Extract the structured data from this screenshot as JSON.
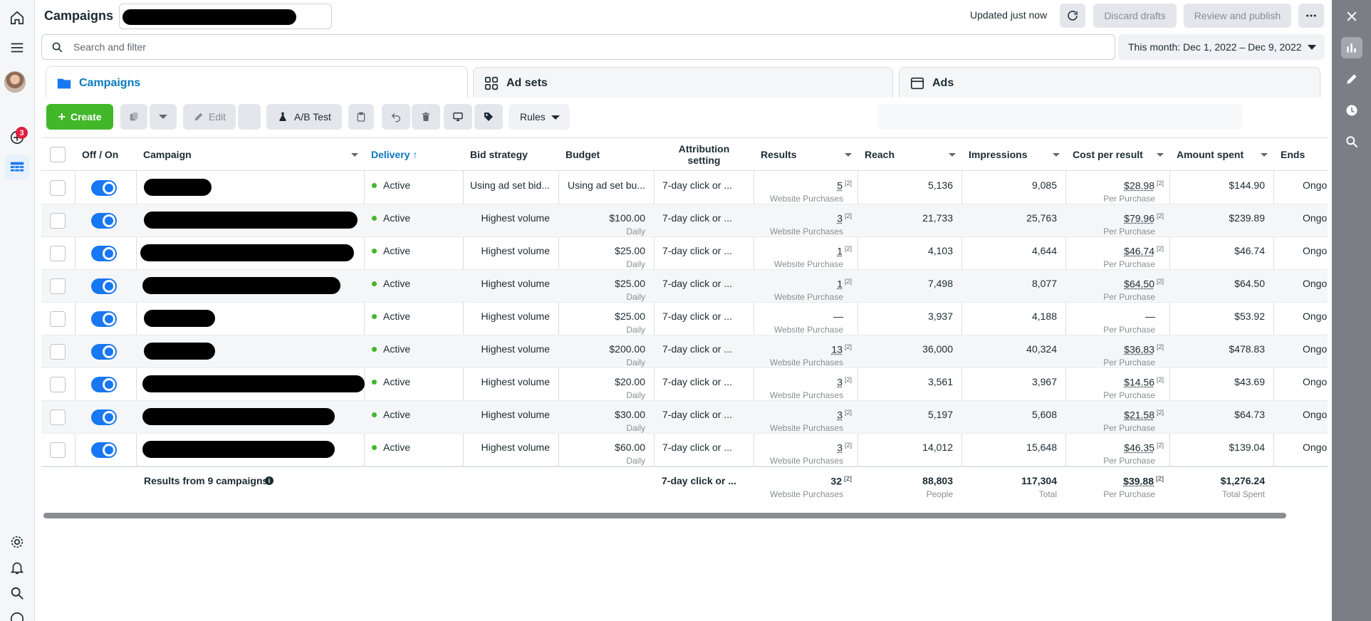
{
  "header": {
    "title": "Campaigns",
    "updated": "Updated just now",
    "discard": "Discard drafts",
    "review": "Review and publish"
  },
  "nav": {
    "notifications_count": "3"
  },
  "search": {
    "placeholder": "Search and filter"
  },
  "date_range": "This month: Dec 1, 2022 – Dec 9, 2022",
  "tabs": [
    {
      "label": "Campaigns"
    },
    {
      "label": "Ad sets"
    },
    {
      "label": "Ads"
    }
  ],
  "toolbar": {
    "create": "Create",
    "edit": "Edit",
    "ab_test": "A/B Test",
    "rules": "Rules"
  },
  "columns": {
    "off_on": "Off / On",
    "campaign": "Campaign",
    "delivery": "Delivery",
    "bid_strategy": "Bid strategy",
    "budget": "Budget",
    "attribution_line1": "Attribution",
    "attribution_line2": "setting",
    "results": "Results",
    "reach": "Reach",
    "impressions": "Impressions",
    "cost_per_result": "Cost per result",
    "amount_spent": "Amount spent",
    "ends": "Ends"
  },
  "rows": [
    {
      "delivery": "Active",
      "bid": "Using ad set bid...",
      "budget": "Using ad set bu...",
      "budget_sub": "",
      "attribution": "7-day click or ...",
      "results": "5",
      "results_sub": "Website Purchases",
      "reach": "5,136",
      "impressions": "9,085",
      "cpr": "$28.98",
      "cpr_sub": "Per Purchase",
      "spent": "$144.90",
      "ends": "Ongoing"
    },
    {
      "delivery": "Active",
      "bid": "Highest volume",
      "budget": "$100.00",
      "budget_sub": "Daily",
      "attribution": "7-day click or ...",
      "results": "3",
      "results_sub": "Website Purchases",
      "reach": "21,733",
      "impressions": "25,763",
      "cpr": "$79.96",
      "cpr_sub": "Per Purchase",
      "spent": "$239.89",
      "ends": "Ongoing"
    },
    {
      "delivery": "Active",
      "bid": "Highest volume",
      "budget": "$25.00",
      "budget_sub": "Daily",
      "attribution": "7-day click or ...",
      "results": "1",
      "results_sub": "Website Purchase",
      "reach": "4,103",
      "impressions": "4,644",
      "cpr": "$46.74",
      "cpr_sub": "Per Purchase",
      "spent": "$46.74",
      "ends": "Ongoing"
    },
    {
      "delivery": "Active",
      "bid": "Highest volume",
      "budget": "$25.00",
      "budget_sub": "Daily",
      "attribution": "7-day click or ...",
      "results": "1",
      "results_sub": "Website Purchase",
      "reach": "7,498",
      "impressions": "8,077",
      "cpr": "$64.50",
      "cpr_sub": "Per Purchase",
      "spent": "$64.50",
      "ends": "Ongoing"
    },
    {
      "delivery": "Active",
      "bid": "Highest volume",
      "budget": "$25.00",
      "budget_sub": "Daily",
      "attribution": "7-day click or ...",
      "results": "—",
      "results_sub": "Website Purchase",
      "reach": "3,937",
      "impressions": "4,188",
      "cpr": "—",
      "cpr_sub": "Per Purchase",
      "spent": "$53.92",
      "ends": "Ongoing"
    },
    {
      "delivery": "Active",
      "bid": "Highest volume",
      "budget": "$200.00",
      "budget_sub": "Daily",
      "attribution": "7-day click or ...",
      "results": "13",
      "results_sub": "Website Purchases",
      "reach": "36,000",
      "impressions": "40,324",
      "cpr": "$36.83",
      "cpr_sub": "Per Purchase",
      "spent": "$478.83",
      "ends": "Ongoing"
    },
    {
      "delivery": "Active",
      "bid": "Highest volume",
      "budget": "$20.00",
      "budget_sub": "Daily",
      "attribution": "7-day click or ...",
      "results": "3",
      "results_sub": "Website Purchases",
      "reach": "3,561",
      "impressions": "3,967",
      "cpr": "$14.56",
      "cpr_sub": "Per Purchase",
      "spent": "$43.69",
      "ends": "Ongoing"
    },
    {
      "delivery": "Active",
      "bid": "Highest volume",
      "budget": "$30.00",
      "budget_sub": "Daily",
      "attribution": "7-day click or ...",
      "results": "3",
      "results_sub": "Website Purchases",
      "reach": "5,197",
      "impressions": "5,608",
      "cpr": "$21.58",
      "cpr_sub": "Per Purchase",
      "spent": "$64.73",
      "ends": "Ongoing"
    },
    {
      "delivery": "Active",
      "bid": "Highest volume",
      "budget": "$60.00",
      "budget_sub": "Daily",
      "attribution": "7-day click or ...",
      "results": "3",
      "results_sub": "Website Purchases",
      "reach": "14,012",
      "impressions": "15,648",
      "cpr": "$46.35",
      "cpr_sub": "Per Purchase",
      "spent": "$139.04",
      "ends": "Ongoing"
    }
  ],
  "footnote_marker": "[2]",
  "summary": {
    "label": "Results from 9 campaigns",
    "attribution": "7-day click or ...",
    "results": "32",
    "results_sub": "Website Purchases",
    "reach": "88,803",
    "reach_sub": "People",
    "impressions": "117,304",
    "impressions_sub": "Total",
    "cpr": "$39.88",
    "cpr_sub": "Per Purchase",
    "spent": "$1,276.24",
    "spent_sub": "Total Spent"
  },
  "colors": {
    "accent": "#0a78be",
    "create": "#42b72a",
    "toggle": "#1877f2",
    "badge": "#e41e3f"
  }
}
